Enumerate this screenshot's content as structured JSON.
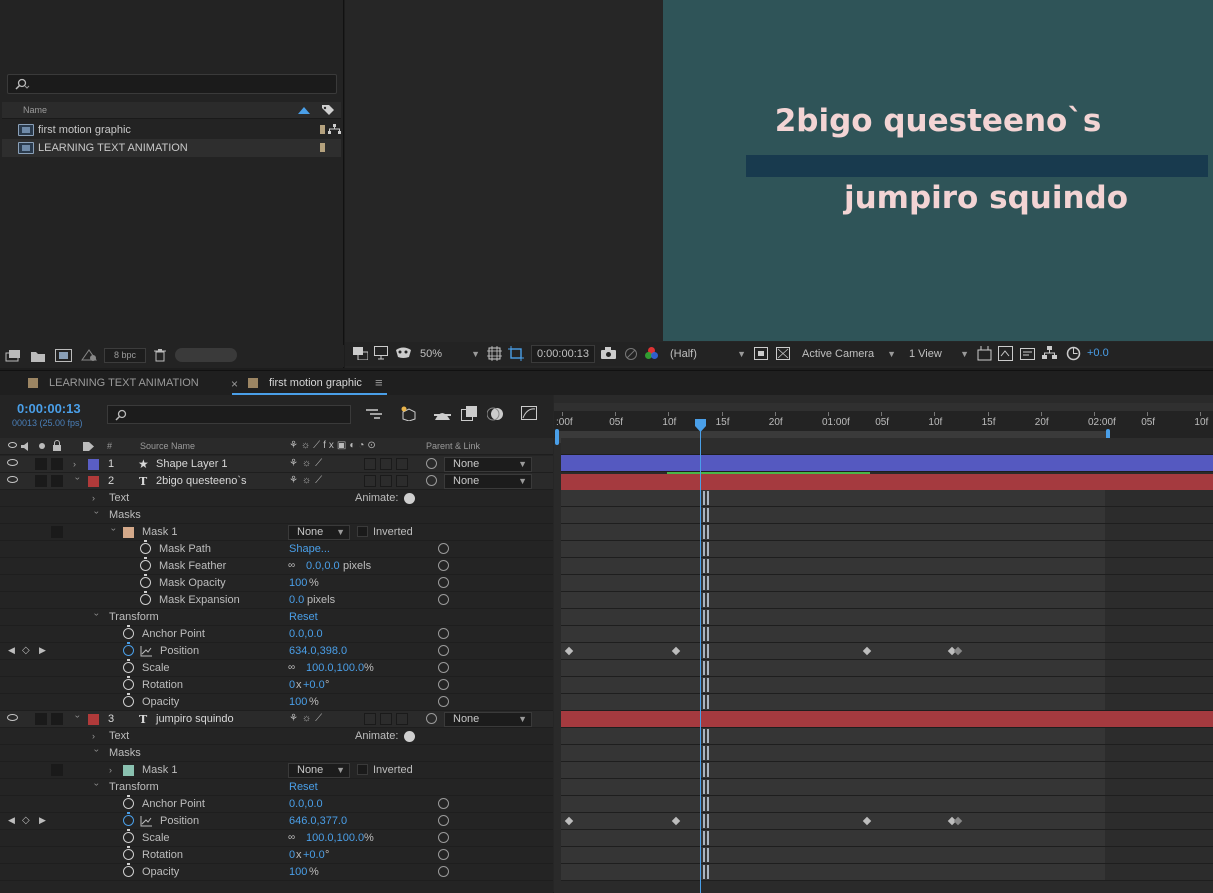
{
  "project": {
    "search_placeholder": "",
    "column_name": "Name",
    "items": [
      {
        "name": "first motion graphic"
      },
      {
        "name": "LEARNING TEXT ANIMATION"
      }
    ],
    "bpc": "8 bpc"
  },
  "viewer": {
    "line1": "2bigo questeeno`s",
    "line2": "jumpiro squindo",
    "zoom": "50%",
    "timecode": "0:00:00:13",
    "resolution": "(Half)",
    "camera": "Active Camera",
    "views": "1 View",
    "exposure": "+0.0",
    "colors": {
      "comp_bg": "#2f5458",
      "text": "#f3d4d4",
      "bar": "#183a4e"
    }
  },
  "timeline": {
    "tabs": [
      {
        "label": "LEARNING TEXT ANIMATION"
      },
      {
        "label": "first motion graphic"
      }
    ],
    "current_time": "0:00:00:13",
    "frame_info": "00013 (25.00 fps)",
    "col_source_name": "Source Name",
    "col_parent": "Parent & Link",
    "ruler": [
      ":00f",
      "05f",
      "10f",
      "15f",
      "20f",
      "01:00f",
      "05f",
      "10f",
      "15f",
      "20f",
      "02:00f",
      "05f",
      "10f"
    ],
    "layers": [
      {
        "num": "1",
        "name": "Shape Layer 1",
        "parent": "None"
      },
      {
        "num": "2",
        "name": "2bigo questeeno`s",
        "parent": "None"
      },
      {
        "num": "3",
        "name": "jumpiro squindo",
        "parent": "None"
      }
    ],
    "labels": {
      "text": "Text",
      "animate": "Animate:",
      "masks": "Masks",
      "mask1": "Mask 1",
      "mask_mode": "None",
      "inverted": "Inverted",
      "mask_path": "Mask Path",
      "mask_feather": "Mask Feather",
      "mask_opacity": "Mask Opacity",
      "mask_expansion": "Mask Expansion",
      "transform": "Transform",
      "reset": "Reset",
      "anchor": "Anchor Point",
      "position": "Position",
      "scale": "Scale",
      "rotation": "Rotation",
      "opacity": "Opacity",
      "pixels": "pixels",
      "percent": "%",
      "degree": "°",
      "x": "x"
    },
    "values": {
      "shape": "Shape...",
      "feather": "0.0,0.0",
      "mask_opacity": "100",
      "expansion": "0.0",
      "anchor": "0.0,0.0",
      "pos2": "634.0,398.0",
      "scale": "100.0,100.0",
      "rot_turns": "0",
      "rot_deg": "+0.0",
      "opacity": "100",
      "pos3": "646.0,377.0"
    }
  }
}
